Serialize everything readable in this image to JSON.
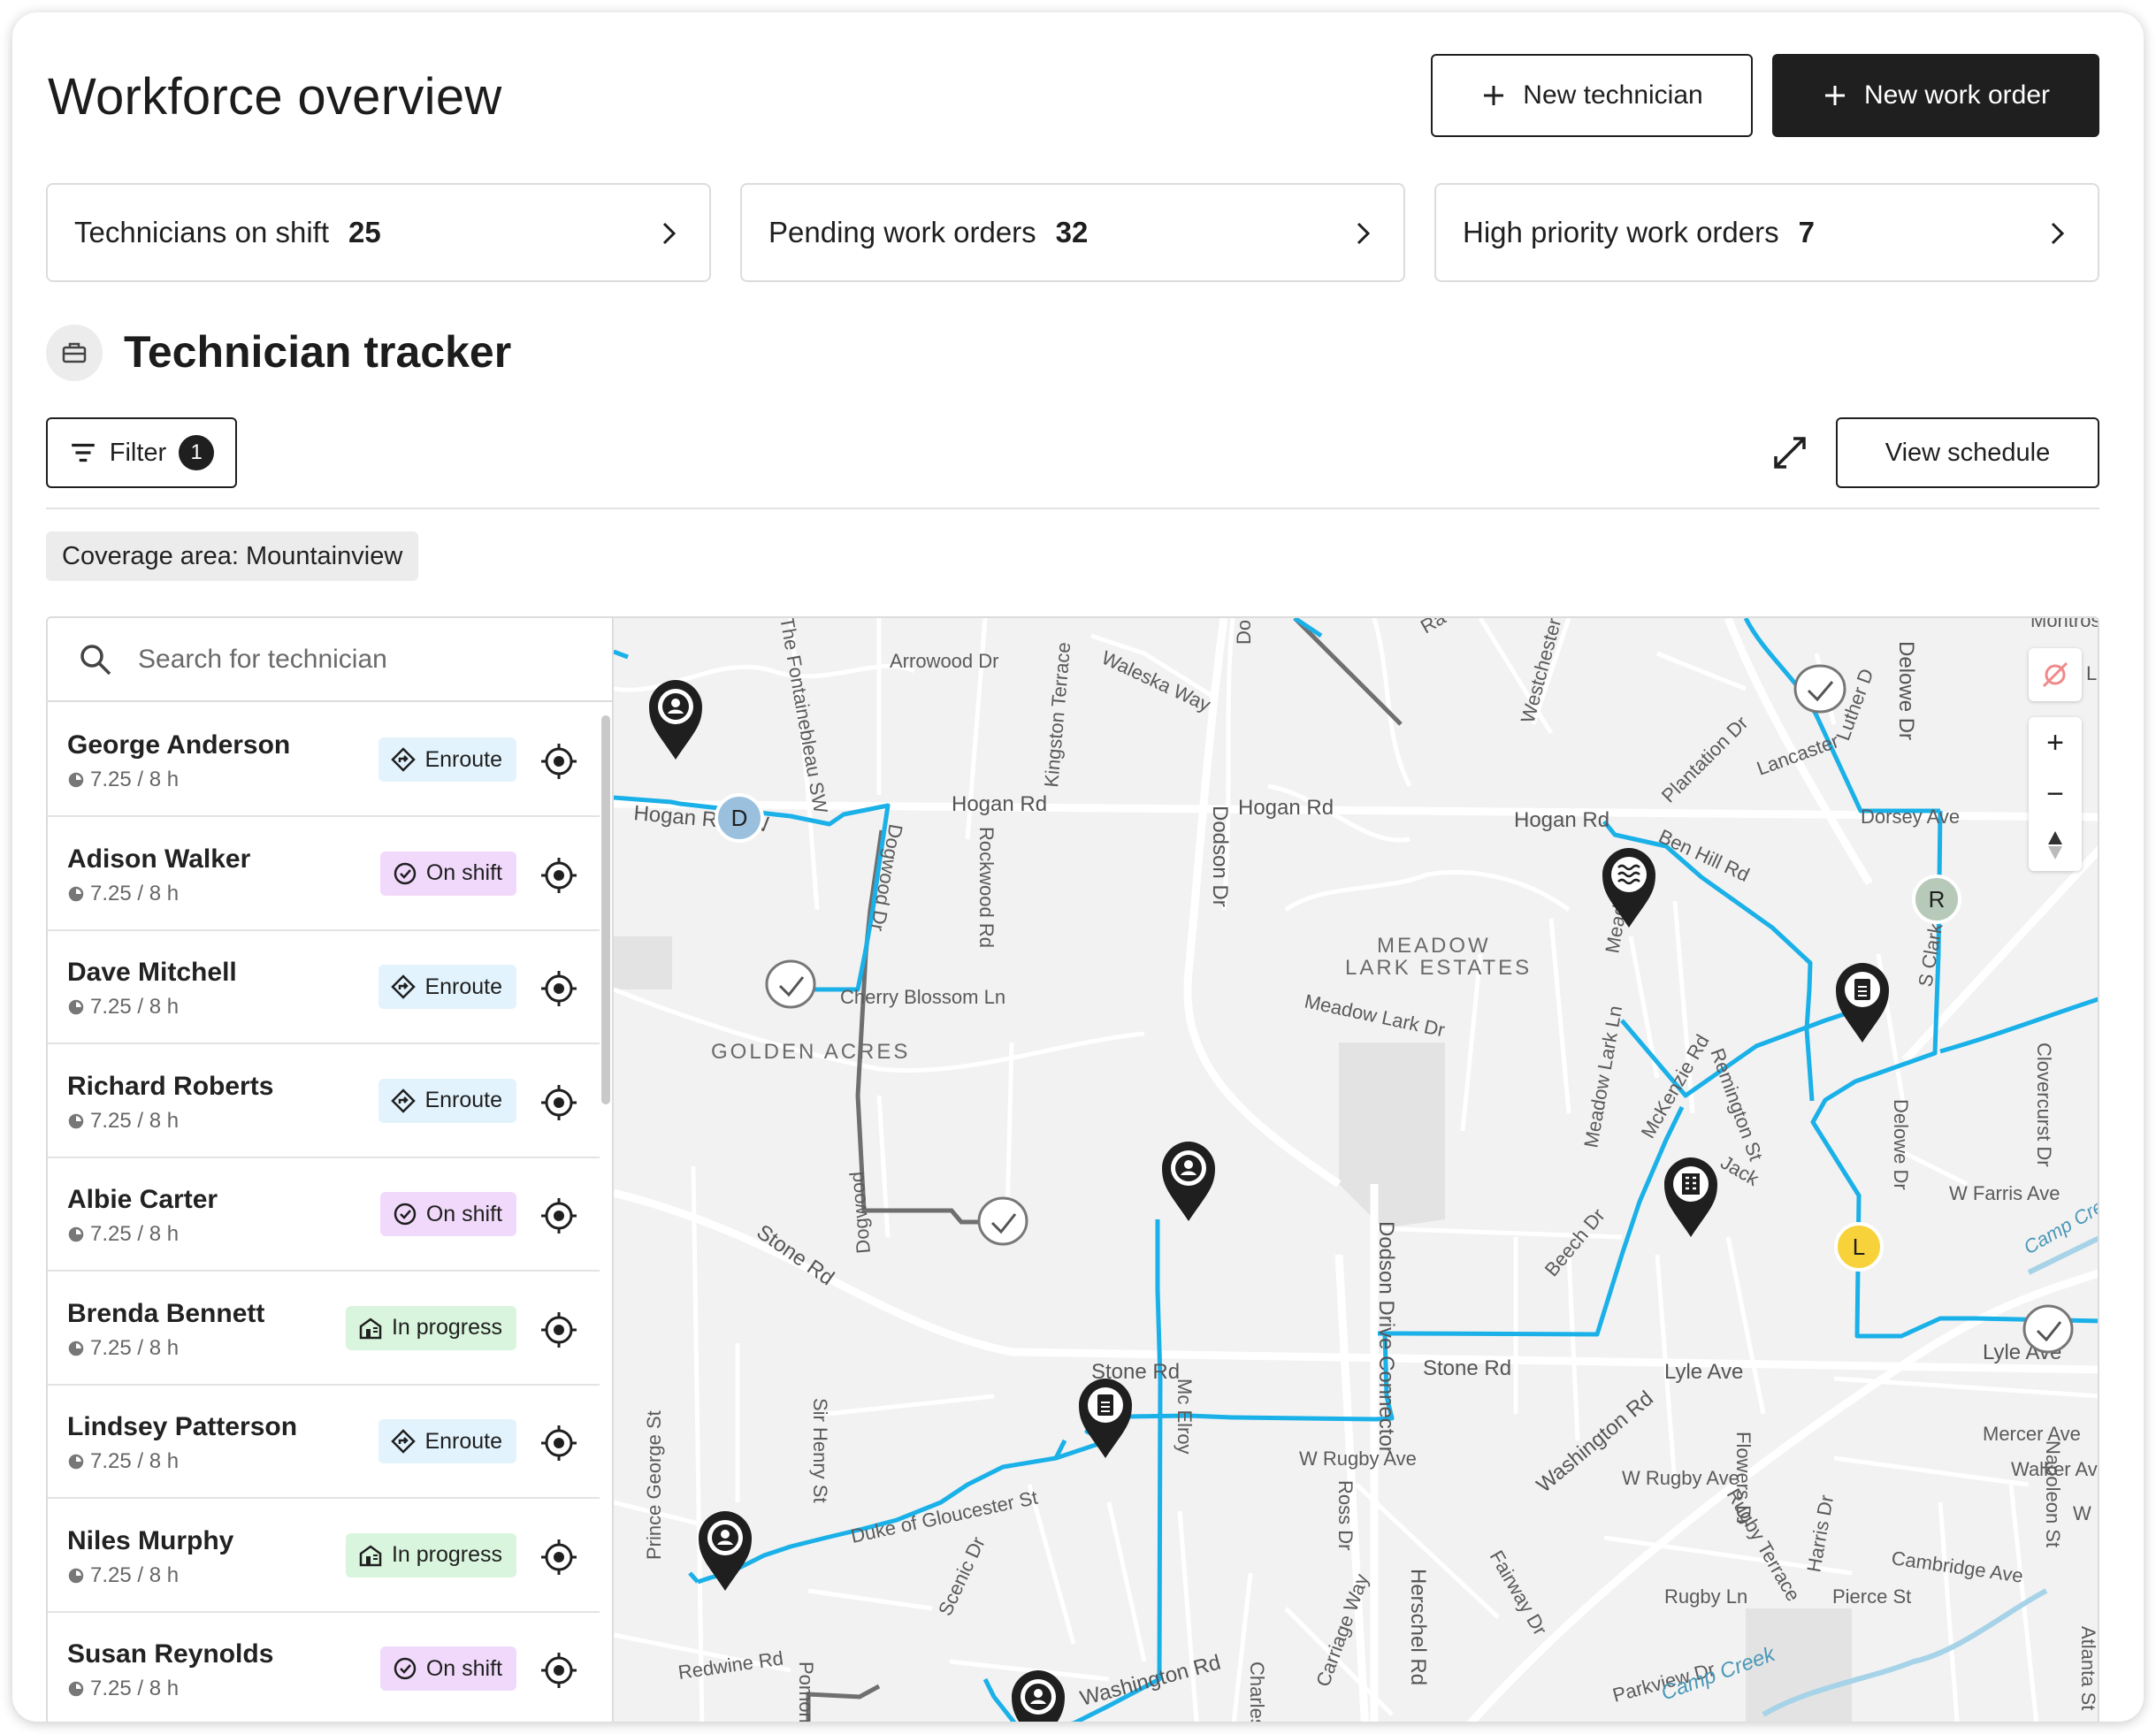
{
  "header": {
    "title": "Workforce overview",
    "new_technician_label": "New technician",
    "new_work_order_label": "New work order"
  },
  "stats": [
    {
      "label": "Technicians on shift",
      "value": "25"
    },
    {
      "label": "Pending work orders",
      "value": "32"
    },
    {
      "label": "High priority work orders",
      "value": "7"
    }
  ],
  "tracker": {
    "title": "Technician tracker",
    "filter_label": "Filter",
    "filter_count": "1",
    "view_schedule_label": "View schedule",
    "coverage_label": "Coverage area: Mountainview",
    "search_placeholder": "Search for technician"
  },
  "technicians": [
    {
      "name": "George Anderson",
      "hours": "7.25 / 8 h",
      "status": "Enroute"
    },
    {
      "name": "Adison Walker",
      "hours": "7.25 / 8 h",
      "status": "On shift"
    },
    {
      "name": "Dave Mitchell",
      "hours": "7.25 / 8 h",
      "status": "Enroute"
    },
    {
      "name": "Richard Roberts",
      "hours": "7.25 / 8 h",
      "status": "Enroute"
    },
    {
      "name": "Albie Carter",
      "hours": "7.25 / 8 h",
      "status": "On shift"
    },
    {
      "name": "Brenda Bennett",
      "hours": "7.25 / 8 h",
      "status": "In progress"
    },
    {
      "name": "Lindsey Patterson",
      "hours": "7.25 / 8 h",
      "status": "Enroute"
    },
    {
      "name": "Niles Murphy",
      "hours": "7.25 / 8 h",
      "status": "In progress"
    },
    {
      "name": "Susan Reynolds",
      "hours": "7.25 / 8 h",
      "status": "On shift"
    }
  ],
  "status_colors": {
    "Enroute": "#e2f3fd",
    "On shift": "#f1d9fb",
    "In progress": "#d9f5dd"
  },
  "map": {
    "route_color": "#1ab0e8",
    "streets": [
      "Arrowood Dr",
      "Waleska Way",
      "Montrose Dr",
      "Hogan Rd SW",
      "Hogan Rd",
      "Hogan Rd",
      "Hogan Rd",
      "Ben Hill Rd",
      "Dorsey Ave",
      "Cherry Blossom Ln",
      "Meadow Lark Dr",
      "Stone Rd",
      "Stone Rd",
      "Stone Rd",
      "Lyle Ave",
      "Lyle Ave",
      "W Rugby Ave",
      "W Rugby Ave",
      "Washington Rd",
      "Washington Rd",
      "Duke of Gloucester St",
      "Redwine Rd",
      "Rugby Ln",
      "Pierce St",
      "Mercer Ave",
      "Walker Av",
      "Cambridge Ave",
      "W Farris Ave",
      "Parkview Dr",
      "Dodson Dr",
      "Dodson Drive Connector",
      "Herschel Rd",
      "Fairway Dr",
      "Carriage Way",
      "Ross Dr",
      "Scenic Dr",
      "Sir Henry St",
      "Prince George St",
      "Pomona Wa",
      "Charles D",
      "Harris Dr",
      "Flowers Dr",
      "Rugby Terrace",
      "Napoleon St",
      "Atlanta St",
      "Beech Dr",
      "McKenzie Rd",
      "Remington St",
      "Meadow Lark Ln",
      "Westchester D",
      "Plantation Dr",
      "Luther D",
      "Delowe Dr",
      "Delowe Dr",
      "S Clark Dr",
      "Clovercurst Dr",
      "Kingston Terrace",
      "Rockwood Rd",
      "Dogwood Dr",
      "Dogwood",
      "The Fontainebleau SW",
      "Lancaster",
      "Ra",
      "Do",
      "Jack",
      "Mead",
      "Mc Elroy",
      "L",
      "W I"
    ],
    "areas": [
      "MEADOW",
      "LARK ESTATES",
      "GOLDEN ACRES"
    ],
    "water": [
      "Camp Creek",
      "Camp Cre"
    ],
    "avatars": [
      "D",
      "R",
      "L"
    ],
    "zoom_in": "+",
    "zoom_out": "−"
  }
}
